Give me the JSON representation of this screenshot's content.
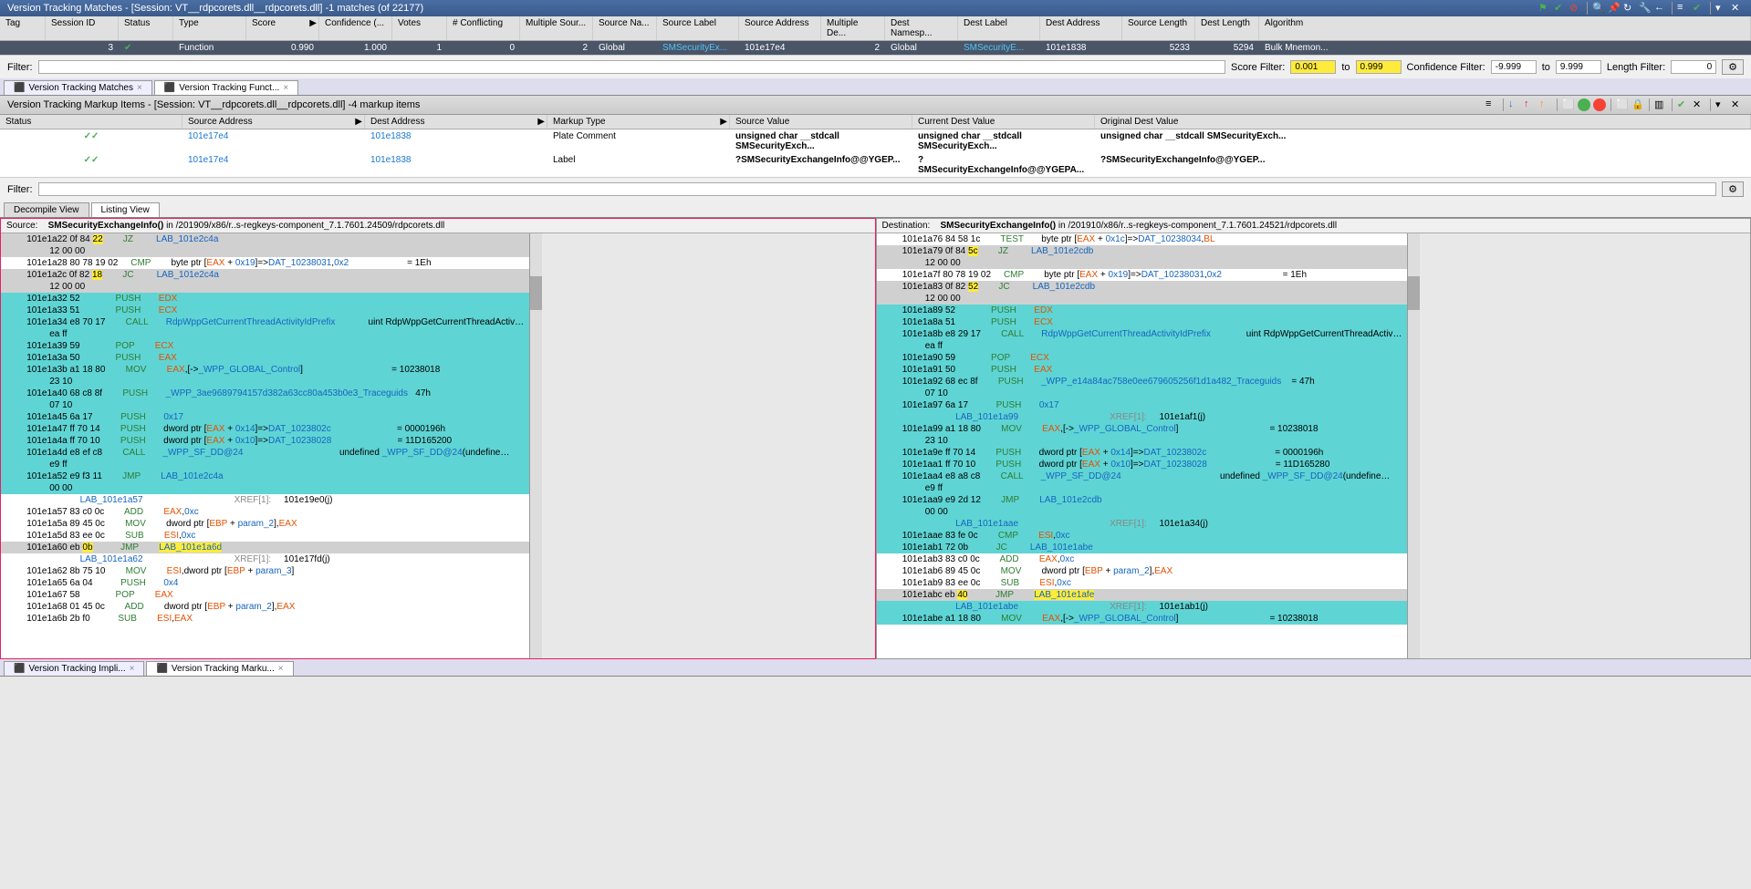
{
  "header": {
    "title": "Version Tracking Matches - [Session: VT__rdpcorets.dll__rdpcorets.dll] -1 matches (of 22177)"
  },
  "matches_table": {
    "cols": [
      "Tag",
      "Session ID",
      "Status",
      "Type",
      "Score",
      "Confidence (...",
      "Votes",
      "# Conflicting",
      "Multiple Sour...",
      "Source Na...",
      "Source Label",
      "Source Address",
      "Multiple De...",
      "Dest Namesp...",
      "Dest Label",
      "Dest Address",
      "Source Length",
      "Dest Length",
      "Algorithm"
    ],
    "row": {
      "tag": "",
      "session": "3",
      "status": "✓",
      "type": "Function",
      "score": "0.990",
      "conf": "1.000",
      "votes": "1",
      "confl": "0",
      "msrc": "2",
      "srcns": "Global",
      "slabel": "SMSecurityEx...",
      "saddr": "101e17e4",
      "mdst": "2",
      "dstns": "Global",
      "dlabel": "SMSecurityE...",
      "daddr": "101e1838",
      "slen": "5233",
      "dlen": "5294",
      "algo": "Bulk Mnemon..."
    }
  },
  "filter": {
    "label": "Filter:",
    "score_filter": "Score Filter:",
    "score_from": "0.001",
    "to": "to",
    "score_to": "0.999",
    "conf_filter": "Confidence Filter:",
    "conf_from": "-9.999",
    "conf_to": "9.999",
    "len_filter": "Length Filter:",
    "len": "0"
  },
  "top_tabs": [
    {
      "label": "Version Tracking Matches",
      "active": false
    },
    {
      "label": "Version Tracking Funct...",
      "active": true
    }
  ],
  "markup": {
    "title": "Version Tracking Markup Items - [Session: VT__rdpcorets.dll__rdpcorets.dll] -4 markup items",
    "cols": [
      "Status",
      "Source Address",
      "Dest Address",
      "Markup Type",
      "Source Value",
      "Current Dest Value",
      "Original Dest Value"
    ],
    "rows": [
      {
        "status": "✓✓",
        "saddr": "101e17e4",
        "daddr": "101e1838",
        "type": "Plate Comment",
        "sval": "unsigned char __stdcall SMSecurityExch...",
        "cval": "unsigned char __stdcall SMSecurityExch...",
        "oval": "unsigned char __stdcall SMSecurityExch..."
      },
      {
        "status": "✓✓",
        "saddr": "101e17e4",
        "daddr": "101e1838",
        "type": "Label",
        "sval": "?SMSecurityExchangeInfo@@YGEP...",
        "cval": "?SMSecurityExchangeInfo@@YGEPA...",
        "oval": "?SMSecurityExchangeInfo@@YGEP..."
      }
    ]
  },
  "view_tabs": [
    {
      "label": "Decompile View",
      "active": false
    },
    {
      "label": "Listing View",
      "active": true
    }
  ],
  "source": {
    "label": "Source:",
    "func": "SMSecurityExchangeInfo()",
    "path": " in /201909/x86/r..s-regkeys-component_7.1.7601.24509/rdpcorets.dll"
  },
  "dest": {
    "label": "Destination:",
    "func": "SMSecurityExchangeInfo()",
    "path": " in /201910/x86/r..s-regkeys-component_7.1.7601.24521/rdpcorets.dll"
  },
  "bottom_tabs": [
    {
      "label": "Version Tracking Impli..."
    },
    {
      "label": "Version Tracking Marku..."
    }
  ],
  "src_lines": [
    {
      "c": "grey",
      "t": "        101e1a22 0f 84 22        JZ         LAB_101e2c4a",
      "hl_bytes": "22"
    },
    {
      "c": "grey",
      "t": "                 12 00 00"
    },
    {
      "c": "",
      "t": "        101e1a28 80 78 19 02     CMP        byte ptr [EAX + 0x19]=>DAT_10238031,0x2                       = 1Eh"
    },
    {
      "c": "grey",
      "t": "        101e1a2c 0f 82 18        JC         LAB_101e2c4a",
      "hl_bytes": "18"
    },
    {
      "c": "grey",
      "t": "                 12 00 00"
    },
    {
      "c": "cyan",
      "t": "        101e1a32 52              PUSH       EDX"
    },
    {
      "c": "cyan",
      "t": "        101e1a33 51              PUSH       ECX"
    },
    {
      "c": "cyan",
      "t": "        101e1a34 e8 70 17        CALL       RdpWppGetCurrentThreadActivityIdPrefix             uint RdpWppGetCurrentThreadActiv…"
    },
    {
      "c": "cyan",
      "t": "                 ea ff"
    },
    {
      "c": "cyan",
      "t": "        101e1a39 59              POP        ECX"
    },
    {
      "c": "cyan",
      "t": "        101e1a3a 50              PUSH       EAX"
    },
    {
      "c": "cyan",
      "t": "        101e1a3b a1 18 80        MOV        EAX,[->_WPP_GLOBAL_Control]                                   = 10238018"
    },
    {
      "c": "cyan",
      "t": "                 23 10"
    },
    {
      "c": "cyan",
      "t": "        101e1a40 68 c8 8f        PUSH       _WPP_3ae9689794157d382a63cc80a453b0e3_Traceguids   47h"
    },
    {
      "c": "cyan",
      "t": "                 07 10"
    },
    {
      "c": "cyan",
      "t": "        101e1a45 6a 17           PUSH       0x17"
    },
    {
      "c": "cyan",
      "t": "        101e1a47 ff 70 14        PUSH       dword ptr [EAX + 0x14]=>DAT_1023802c                          = 0000196h"
    },
    {
      "c": "cyan",
      "t": "        101e1a4a ff 70 10        PUSH       dword ptr [EAX + 0x10]=>DAT_10238028                          = 11D165200"
    },
    {
      "c": "cyan",
      "t": "        101e1a4d e8 ef c8        CALL       _WPP_SF_DD@24                                      undefined _WPP_SF_DD@24(undefine…"
    },
    {
      "c": "cyan",
      "t": "                 e9 ff"
    },
    {
      "c": "cyan",
      "t": "        101e1a52 e9 f3 11        JMP        LAB_101e2c4a"
    },
    {
      "c": "cyan",
      "t": "                 00 00"
    },
    {
      "c": "",
      "t": "                             LAB_101e1a57                                    XREF[1]:     101e19e0(j)  "
    },
    {
      "c": "",
      "t": "        101e1a57 83 c0 0c        ADD        EAX,0xc"
    },
    {
      "c": "",
      "t": "        101e1a5a 89 45 0c        MOV        dword ptr [EBP + param_2],EAX"
    },
    {
      "c": "",
      "t": "        101e1a5d 83 ee 0c        SUB        ESI,0xc"
    },
    {
      "c": "grey",
      "t": "        101e1a60 eb 0b           JMP        LAB_101e1a6d",
      "hl_bytes": "0b",
      "hl_lab": true
    },
    {
      "c": "",
      "t": "                             LAB_101e1a62                                    XREF[1]:     101e17fd(j)  "
    },
    {
      "c": "",
      "t": "        101e1a62 8b 75 10        MOV        ESI,dword ptr [EBP + param_3]"
    },
    {
      "c": "",
      "t": "        101e1a65 6a 04           PUSH       0x4"
    },
    {
      "c": "",
      "t": "        101e1a67 58              POP        EAX"
    },
    {
      "c": "",
      "t": "        101e1a68 01 45 0c        ADD        dword ptr [EBP + param_2],EAX"
    },
    {
      "c": "",
      "t": "        101e1a6b 2b f0           SUB        ESI,EAX"
    }
  ],
  "dst_lines": [
    {
      "c": "",
      "t": "        101e1a76 84 58 1c        TEST       byte ptr [EAX + 0x1c]=>DAT_10238034,BL"
    },
    {
      "c": "grey",
      "t": "        101e1a79 0f 84 5c        JZ         LAB_101e2cdb",
      "hl_bytes": "5c"
    },
    {
      "c": "grey",
      "t": "                 12 00 00"
    },
    {
      "c": "",
      "t": "        101e1a7f 80 78 19 02     CMP        byte ptr [EAX + 0x19]=>DAT_10238031,0x2                        = 1Eh"
    },
    {
      "c": "grey",
      "t": "        101e1a83 0f 82 52        JC         LAB_101e2cdb",
      "hl_bytes": "52"
    },
    {
      "c": "grey",
      "t": "                 12 00 00"
    },
    {
      "c": "cyan",
      "t": "        101e1a89 52              PUSH       EDX"
    },
    {
      "c": "cyan",
      "t": "        101e1a8a 51              PUSH       ECX"
    },
    {
      "c": "cyan",
      "t": "        101e1a8b e8 29 17        CALL       RdpWppGetCurrentThreadActivityIdPrefix              uint RdpWppGetCurrentThreadActiv…"
    },
    {
      "c": "cyan",
      "t": "                 ea ff"
    },
    {
      "c": "cyan",
      "t": "        101e1a90 59              POP        ECX"
    },
    {
      "c": "cyan",
      "t": "        101e1a91 50              PUSH       EAX"
    },
    {
      "c": "cyan",
      "t": "        101e1a92 68 ec 8f        PUSH       _WPP_e14a84ac758e0ee679605256f1d1a482_Traceguids    = 47h"
    },
    {
      "c": "cyan",
      "t": "                 07 10"
    },
    {
      "c": "cyan",
      "t": "        101e1a97 6a 17           PUSH       0x17"
    },
    {
      "c": "cyan",
      "t": "                             LAB_101e1a99                                    XREF[1]:     101e1af1(j)  "
    },
    {
      "c": "cyan",
      "t": "        101e1a99 a1 18 80        MOV        EAX,[->_WPP_GLOBAL_Control]                                    = 10238018"
    },
    {
      "c": "cyan",
      "t": "                 23 10"
    },
    {
      "c": "cyan",
      "t": "        101e1a9e ff 70 14        PUSH       dword ptr [EAX + 0x14]=>DAT_1023802c                           = 0000196h"
    },
    {
      "c": "cyan",
      "t": "        101e1aa1 ff 70 10        PUSH       dword ptr [EAX + 0x10]=>DAT_10238028                           = 11D165280"
    },
    {
      "c": "cyan",
      "t": "        101e1aa4 e8 a8 c8        CALL       _WPP_SF_DD@24                                       undefined _WPP_SF_DD@24(undefine…"
    },
    {
      "c": "cyan",
      "t": "                 e9 ff"
    },
    {
      "c": "cyan",
      "t": "        101e1aa9 e9 2d 12        JMP        LAB_101e2cdb"
    },
    {
      "c": "cyan",
      "t": "                 00 00"
    },
    {
      "c": "cyan",
      "t": "                             LAB_101e1aae                                    XREF[1]:     101e1a34(j)  "
    },
    {
      "c": "cyan",
      "t": "        101e1aae 83 fe 0c        CMP        ESI,0xc"
    },
    {
      "c": "cyan",
      "t": "        101e1ab1 72 0b           JC         LAB_101e1abe"
    },
    {
      "c": "",
      "t": "        101e1ab3 83 c0 0c        ADD        EAX,0xc"
    },
    {
      "c": "",
      "t": "        101e1ab6 89 45 0c        MOV        dword ptr [EBP + param_2],EAX"
    },
    {
      "c": "",
      "t": "        101e1ab9 83 ee 0c        SUB        ESI,0xc"
    },
    {
      "c": "grey",
      "t": "        101e1abc eb 40           JMP        LAB_101e1afe",
      "hl_bytes": "40",
      "hl_lab": true
    },
    {
      "c": "cyan",
      "t": "                             LAB_101e1abe                                    XREF[1]:     101e1ab1(j)  "
    },
    {
      "c": "cyan",
      "t": "        101e1abe a1 18 80        MOV        EAX,[->_WPP_GLOBAL_Control]                                    = 10238018"
    }
  ]
}
